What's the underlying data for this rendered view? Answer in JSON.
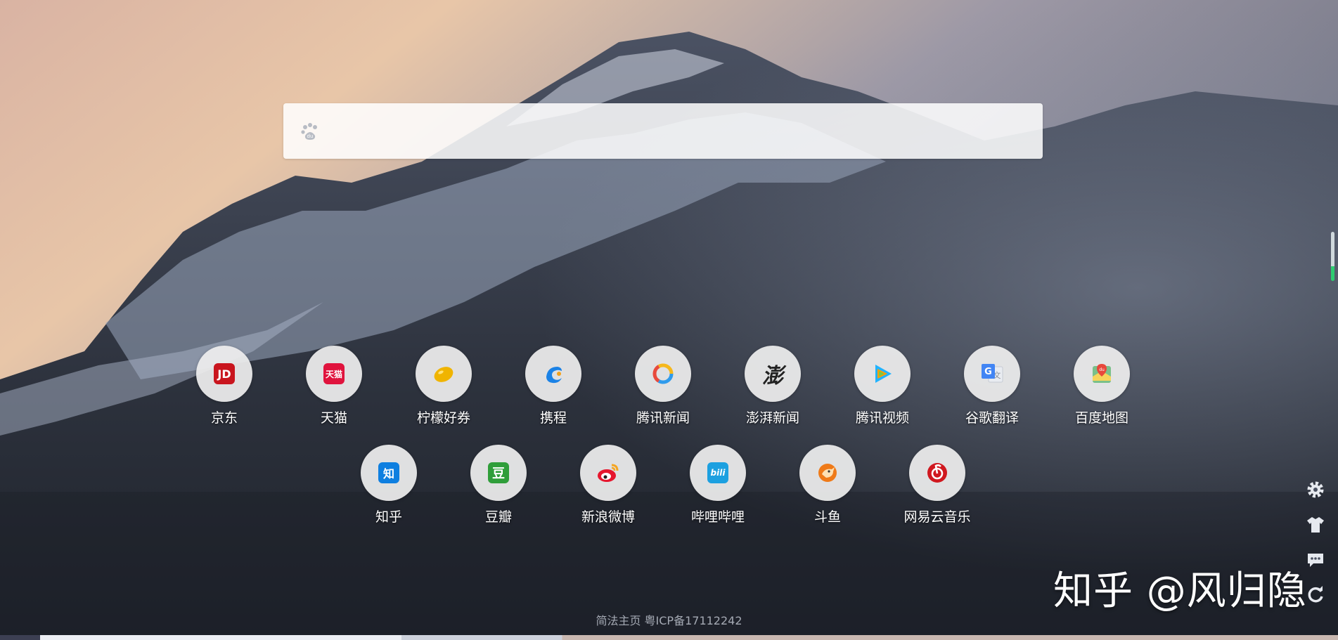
{
  "search": {
    "placeholder": ""
  },
  "tiles_row1": [
    {
      "label": "京东",
      "icon": "jd-icon",
      "logo_text": "JD",
      "color": "#c9151e"
    },
    {
      "label": "天猫",
      "icon": "tmall-icon",
      "logo_text": "天猫",
      "color": "#e0133d"
    },
    {
      "label": "柠檬好券",
      "icon": "lemon-icon",
      "logo_text": "",
      "color": "#f0b400"
    },
    {
      "label": "携程",
      "icon": "ctrip-icon",
      "logo_text": "",
      "color": "#1b82e6"
    },
    {
      "label": "腾讯新闻",
      "icon": "tencent-news-icon",
      "logo_text": "",
      "color": "#e84a3c"
    },
    {
      "label": "澎湃新闻",
      "icon": "thepaper-icon",
      "logo_text": "澎",
      "color": "#222222"
    },
    {
      "label": "腾讯视频",
      "icon": "tencent-video-icon",
      "logo_text": "",
      "color": "#22b3ff"
    },
    {
      "label": "谷歌翻译",
      "icon": "google-translate-icon",
      "logo_text": "G",
      "color": "#4285f4"
    },
    {
      "label": "百度地图",
      "icon": "baidu-map-icon",
      "logo_text": "du",
      "color": "#e8473b"
    }
  ],
  "tiles_row2": [
    {
      "label": "知乎",
      "icon": "zhihu-icon",
      "logo_text": "知",
      "color": "#0e7fe0"
    },
    {
      "label": "豆瓣",
      "icon": "douban-icon",
      "logo_text": "豆",
      "color": "#2f9e3a"
    },
    {
      "label": "新浪微博",
      "icon": "weibo-icon",
      "logo_text": "",
      "color": "#e6162d"
    },
    {
      "label": "哔哩哔哩",
      "icon": "bilibili-icon",
      "logo_text": "bili",
      "color": "#1ca0e0"
    },
    {
      "label": "斗鱼",
      "icon": "douyu-icon",
      "logo_text": "",
      "color": "#ef7a18"
    },
    {
      "label": "网易云音乐",
      "icon": "netease-music-icon",
      "logo_text": "",
      "color": "#d0181f"
    }
  ],
  "footer": {
    "text": "简法主页 粤ICP备17112242"
  },
  "watermark": {
    "text": "知乎 @风归隐"
  },
  "side_tools": [
    {
      "icon": "gear-icon"
    },
    {
      "icon": "shirt-icon"
    },
    {
      "icon": "chat-icon"
    },
    {
      "icon": "refresh-icon"
    }
  ]
}
